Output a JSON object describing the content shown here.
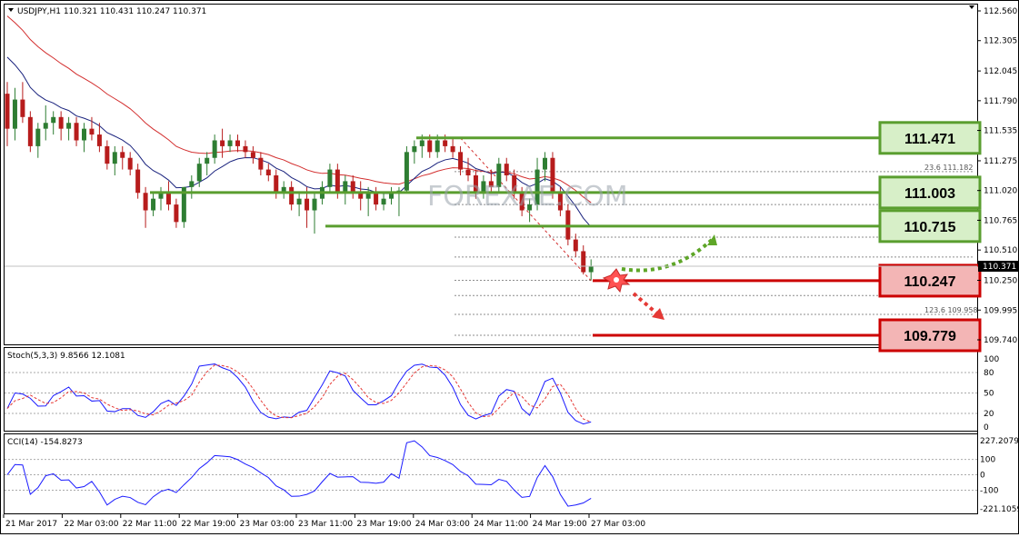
{
  "symbol_header": "USDJPY,H1  110.321 110.431 110.247 110.371",
  "stoch_header": "Stoch(5,3,3) 9.8566 12.1081",
  "cci_header": "CCI(14) -154.8273",
  "watermark": "FOREXAE.COM",
  "colors": {
    "bull": "#2e7d32",
    "bear": "#b71c1c",
    "ma_blue": "#1a237e",
    "ma_red": "#d32f2f",
    "support_green": "#5a9e2f",
    "green_box_fill": "#d7efc8",
    "red_box_fill": "#f3b5b5",
    "red_line": "#cc0000"
  },
  "price_axis": {
    "min": 109.74,
    "max": 112.56,
    "ticks": [
      "112.560",
      "112.305",
      "112.045",
      "111.790",
      "111.535",
      "111.275",
      "111.020",
      "110.765",
      "110.510",
      "110.250",
      "109.995",
      "109.740"
    ],
    "current": "110.371"
  },
  "stoch_axis": {
    "ticks": [
      "100",
      "80",
      "50",
      "20",
      "0"
    ]
  },
  "cci_axis": {
    "ticks": [
      "227.2079",
      "100",
      "0",
      "-100",
      "-221.1059"
    ]
  },
  "time_axis": {
    "labels": [
      "21 Mar 2017",
      "22 Mar 03:00",
      "22 Mar 11:00",
      "22 Mar 19:00",
      "23 Mar 03:00",
      "23 Mar 11:00",
      "23 Mar 19:00",
      "24 Mar 03:00",
      "24 Mar 11:00",
      "24 Mar 19:00",
      "27 Mar 03:00"
    ]
  },
  "levels": {
    "green": [
      {
        "label": "111.471",
        "value": 111.471
      },
      {
        "label": "111.003",
        "value": 111.003
      },
      {
        "label": "110.715",
        "value": 110.715
      }
    ],
    "red": [
      {
        "label": "110.247",
        "value": 110.247
      },
      {
        "label": "109.779",
        "value": 109.779
      }
    ]
  },
  "fib_labels": [
    {
      "text": "23.6  111.182",
      "value": 111.182
    },
    {
      "text": "123.6  109.958",
      "value": 109.958
    }
  ],
  "chart_data": {
    "type": "candlestick",
    "timeframe": "H1",
    "candles": [
      [
        111.85,
        111.95,
        111.4,
        111.55
      ],
      [
        111.55,
        111.9,
        111.45,
        111.8
      ],
      [
        111.8,
        111.95,
        111.6,
        111.65
      ],
      [
        111.65,
        111.7,
        111.35,
        111.4
      ],
      [
        111.4,
        111.6,
        111.3,
        111.55
      ],
      [
        111.55,
        111.75,
        111.45,
        111.6
      ],
      [
        111.6,
        111.7,
        111.5,
        111.65
      ],
      [
        111.65,
        111.7,
        111.45,
        111.55
      ],
      [
        111.55,
        111.65,
        111.45,
        111.6
      ],
      [
        111.6,
        111.65,
        111.4,
        111.45
      ],
      [
        111.45,
        111.6,
        111.35,
        111.55
      ],
      [
        111.55,
        111.65,
        111.45,
        111.5
      ],
      [
        111.5,
        111.6,
        111.35,
        111.4
      ],
      [
        111.4,
        111.45,
        111.2,
        111.25
      ],
      [
        111.25,
        111.4,
        111.15,
        111.35
      ],
      [
        111.35,
        111.4,
        111.2,
        111.3
      ],
      [
        111.3,
        111.35,
        111.15,
        111.2
      ],
      [
        111.2,
        111.25,
        110.95,
        111.0
      ],
      [
        111.0,
        111.05,
        110.7,
        110.85
      ],
      [
        110.85,
        111.0,
        110.8,
        110.95
      ],
      [
        110.95,
        111.05,
        110.85,
        111.0
      ],
      [
        111.0,
        111.1,
        110.85,
        110.9
      ],
      [
        110.9,
        110.95,
        110.7,
        110.75
      ],
      [
        110.75,
        111.05,
        110.7,
        111.05
      ],
      [
        111.05,
        111.15,
        110.95,
        111.1
      ],
      [
        111.1,
        111.3,
        111.05,
        111.25
      ],
      [
        111.25,
        111.35,
        111.15,
        111.3
      ],
      [
        111.3,
        111.5,
        111.25,
        111.45
      ],
      [
        111.45,
        111.55,
        111.3,
        111.4
      ],
      [
        111.4,
        111.5,
        111.35,
        111.45
      ],
      [
        111.45,
        111.5,
        111.35,
        111.4
      ],
      [
        111.4,
        111.45,
        111.3,
        111.35
      ],
      [
        111.35,
        111.4,
        111.25,
        111.3
      ],
      [
        111.3,
        111.35,
        111.15,
        111.2
      ],
      [
        111.2,
        111.25,
        111.1,
        111.15
      ],
      [
        111.15,
        111.2,
        110.95,
        111.0
      ],
      [
        111.0,
        111.1,
        110.95,
        111.05
      ],
      [
        111.05,
        111.1,
        110.85,
        110.9
      ],
      [
        110.9,
        111.0,
        110.8,
        110.95
      ],
      [
        110.95,
        111.05,
        110.7,
        110.85
      ],
      [
        110.85,
        111.0,
        110.65,
        110.95
      ],
      [
        110.95,
        111.1,
        110.9,
        111.05
      ],
      [
        111.05,
        111.25,
        111.0,
        111.2
      ],
      [
        111.2,
        111.25,
        110.95,
        111.0
      ],
      [
        111.0,
        111.15,
        110.9,
        111.1
      ],
      [
        111.1,
        111.15,
        110.95,
        111.0
      ],
      [
        111.0,
        111.1,
        110.85,
        110.95
      ],
      [
        110.95,
        111.05,
        110.8,
        111.0
      ],
      [
        111.0,
        111.05,
        110.85,
        110.9
      ],
      [
        110.9,
        111.0,
        110.85,
        110.95
      ],
      [
        110.95,
        111.05,
        110.9,
        111.0
      ],
      [
        111.0,
        111.05,
        110.8,
        111.02
      ],
      [
        111.02,
        111.4,
        111.0,
        111.35
      ],
      [
        111.35,
        111.45,
        111.25,
        111.4
      ],
      [
        111.4,
        111.5,
        111.3,
        111.45
      ],
      [
        111.45,
        111.5,
        111.3,
        111.35
      ],
      [
        111.35,
        111.5,
        111.3,
        111.45
      ],
      [
        111.45,
        111.5,
        111.35,
        111.4
      ],
      [
        111.4,
        111.47,
        111.3,
        111.35
      ],
      [
        111.35,
        111.4,
        111.15,
        111.2
      ],
      [
        111.2,
        111.3,
        111.1,
        111.15
      ],
      [
        111.15,
        111.2,
        110.95,
        111.0
      ],
      [
        111.0,
        111.15,
        110.95,
        111.1
      ],
      [
        111.1,
        111.2,
        111.0,
        111.05
      ],
      [
        111.05,
        111.3,
        111.0,
        111.25
      ],
      [
        111.25,
        111.3,
        111.1,
        111.15
      ],
      [
        111.15,
        111.2,
        110.95,
        111.0
      ],
      [
        111.0,
        111.05,
        110.8,
        110.85
      ],
      [
        110.85,
        110.95,
        110.75,
        110.9
      ],
      [
        110.9,
        111.3,
        110.85,
        111.2
      ],
      [
        111.2,
        111.35,
        111.1,
        111.3
      ],
      [
        111.3,
        111.35,
        110.95,
        111.0
      ],
      [
        111.0,
        111.05,
        110.8,
        110.85
      ],
      [
        110.85,
        110.9,
        110.55,
        110.6
      ],
      [
        110.6,
        110.65,
        110.45,
        110.5
      ],
      [
        110.5,
        110.55,
        110.3,
        110.32
      ],
      [
        110.32,
        110.43,
        110.25,
        110.37
      ]
    ]
  }
}
